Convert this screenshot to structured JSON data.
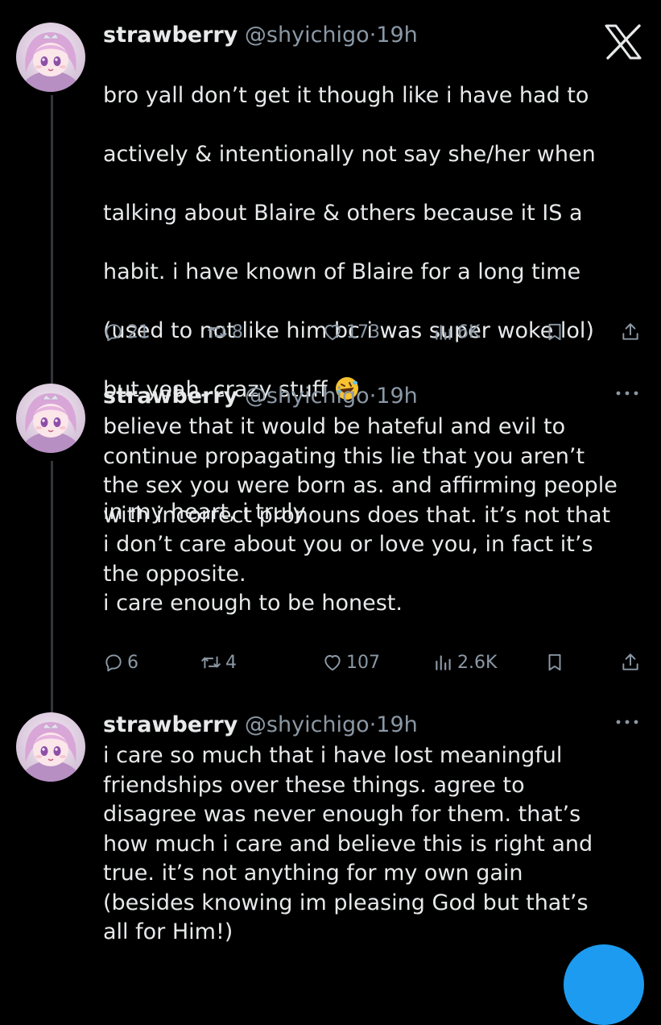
{
  "tweets": [
    {
      "name": "strawberry",
      "handle": "@shyichigo",
      "dot": "·",
      "time": "19h",
      "text_lines": [
        "bro yall don’t get it though like i have had to",
        "actively & intentionally not say she/her when",
        "talking about Blaire & others because it IS a",
        "habit. i have known of Blaire for a long time",
        "(used to not like him bc i was super woke lol)",
        "but yeah. crazy stuff"
      ],
      "emoji": "rolling-on-floor-laughing",
      "text_after": "in my heart, i truly",
      "replies": "21",
      "reposts": "8",
      "likes": "173",
      "views": "6K"
    },
    {
      "name": "strawberry",
      "handle": "@shyichigo",
      "dot": "·",
      "time": "19h",
      "text": "believe that it would be hateful and evil to\ncontinue propagating this lie that you aren’t\nthe sex you were born as. and affirming people\nwith incorrect pronouns does that. it’s not that\ni don’t care about you or love you, in fact it’s\nthe opposite.\ni care enough to be honest.",
      "replies": "6",
      "reposts": "4",
      "likes": "107",
      "views": "2.6K"
    },
    {
      "name": "strawberry",
      "handle": "@shyichigo",
      "dot": "·",
      "time": "19h",
      "text": "i care so much that i have lost meaningful\nfriendships over these things. agree to\ndisagree was never enough for them. that’s\nhow much i care and believe this is right and\ntrue. it’s not anything for my own gain\n(besides knowing im pleasing God but that’s\nall for Him!)"
    }
  ],
  "icons": {
    "close": "x-close-icon",
    "more": "more-icon",
    "reply": "reply-icon",
    "repost": "repost-icon",
    "like": "heart-icon",
    "views": "views-icon",
    "bookmark": "bookmark-icon",
    "share": "share-icon"
  },
  "colors": {
    "background": "#000000",
    "text": "#e7e9ea",
    "secondary": "#8b98a5",
    "thread_line": "#333639",
    "accent": "#1d9bf0"
  }
}
